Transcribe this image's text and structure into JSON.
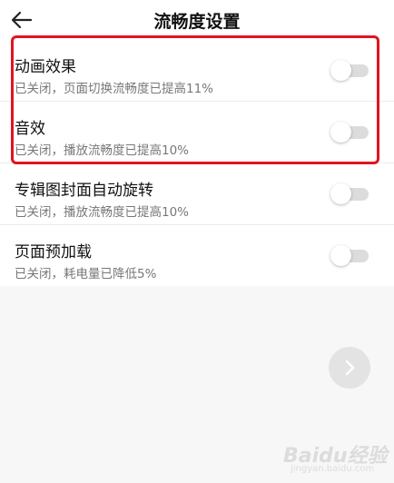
{
  "header": {
    "title": "流畅度设置",
    "back_icon": "arrow-left-icon"
  },
  "settings": [
    {
      "title": "动画效果",
      "subtitle": "已关闭，页面切换流畅度已提高11%",
      "enabled": false
    },
    {
      "title": "音效",
      "subtitle": "已关闭，播放流畅度已提高10%",
      "enabled": false
    },
    {
      "title": "专辑图封面自动旋转",
      "subtitle": "已关闭，播放流畅度已提高10%",
      "enabled": false
    },
    {
      "title": "页面预加载",
      "subtitle": "已关闭，耗电量已降低5%",
      "enabled": false
    }
  ],
  "fab": {
    "icon": "chevron-right-icon"
  },
  "watermark": {
    "brand": "Baidu经验",
    "sub": "jingyan.baidu.com"
  },
  "colors": {
    "highlight": "#e1141e",
    "toggle_track_off": "#dcdcdc",
    "subtitle": "#777777",
    "background": "#f7f7f7"
  }
}
